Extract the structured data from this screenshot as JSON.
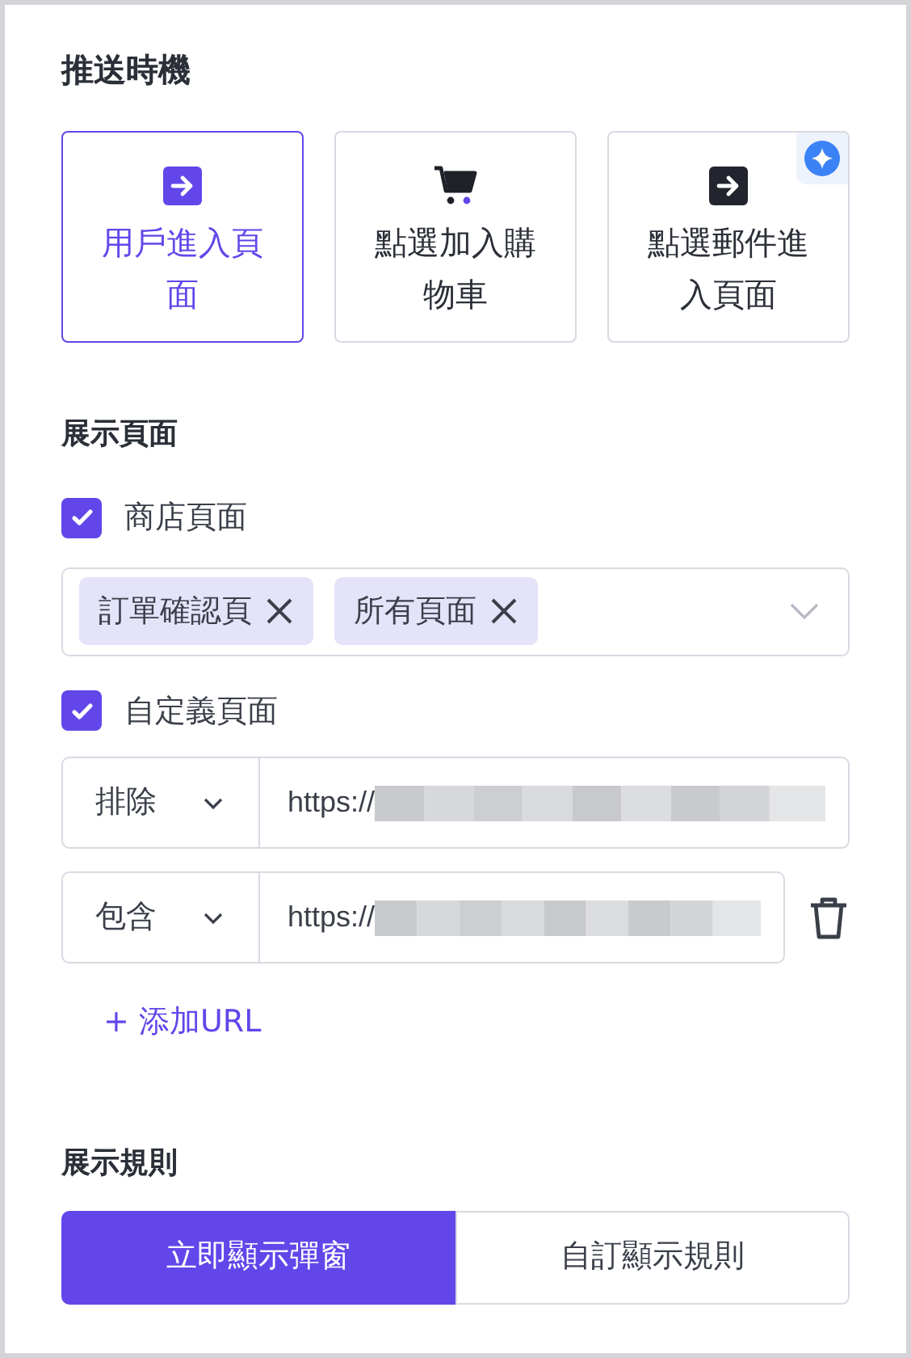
{
  "push_timing": {
    "title": "推送時機",
    "options": [
      {
        "label": "用戶進入頁面",
        "kind": "enter",
        "selected": true,
        "badge": false
      },
      {
        "label": "點選加入購物車",
        "kind": "cart",
        "selected": false,
        "badge": false
      },
      {
        "label": "點選郵件進入頁面",
        "kind": "enter",
        "selected": false,
        "badge": true
      }
    ]
  },
  "display_pages": {
    "title": "展示頁面",
    "store_pages": {
      "label": "商店頁面",
      "checked": true,
      "tags": [
        "訂單確認頁",
        "所有頁面"
      ]
    },
    "custom_pages": {
      "label": "自定義頁面",
      "checked": true,
      "rules": [
        {
          "mode": "排除",
          "url": "https://",
          "deletable": false
        },
        {
          "mode": "包含",
          "url": "https://",
          "deletable": true
        }
      ]
    },
    "add_url": "+ 添加URL"
  },
  "display_rules": {
    "title": "展示規則",
    "options": [
      {
        "label": "立即顯示彈窗",
        "selected": true
      },
      {
        "label": "自訂顯示規則",
        "selected": false
      }
    ]
  }
}
